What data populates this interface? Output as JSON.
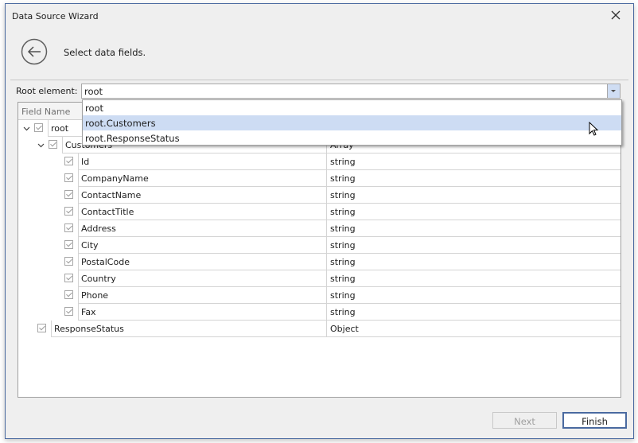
{
  "window": {
    "title": "Data Source Wizard",
    "close_icon": "close-icon",
    "back_icon": "back-arrow-icon",
    "subtitle": "Select data fields."
  },
  "root_element": {
    "label": "Root element:",
    "value": "root",
    "options": [
      {
        "label": "root",
        "selected": false
      },
      {
        "label": "root.Customers",
        "selected": true
      },
      {
        "label": "root.ResponseStatus",
        "selected": false
      }
    ]
  },
  "grid": {
    "header_field_name": "Field Name",
    "rows": [
      {
        "name": "root",
        "type": "",
        "level": 0,
        "expandable": true,
        "checked": true
      },
      {
        "name": "Customers",
        "type": "Array",
        "level": 1,
        "expandable": true,
        "checked": true
      },
      {
        "name": "Id",
        "type": "string",
        "level": 2,
        "expandable": false,
        "checked": true
      },
      {
        "name": "CompanyName",
        "type": "string",
        "level": 2,
        "expandable": false,
        "checked": true
      },
      {
        "name": "ContactName",
        "type": "string",
        "level": 2,
        "expandable": false,
        "checked": true
      },
      {
        "name": "ContactTitle",
        "type": "string",
        "level": 2,
        "expandable": false,
        "checked": true
      },
      {
        "name": "Address",
        "type": "string",
        "level": 2,
        "expandable": false,
        "checked": true
      },
      {
        "name": "City",
        "type": "string",
        "level": 2,
        "expandable": false,
        "checked": true
      },
      {
        "name": "PostalCode",
        "type": "string",
        "level": 2,
        "expandable": false,
        "checked": true
      },
      {
        "name": "Country",
        "type": "string",
        "level": 2,
        "expandable": false,
        "checked": true
      },
      {
        "name": "Phone",
        "type": "string",
        "level": 2,
        "expandable": false,
        "checked": true
      },
      {
        "name": "Fax",
        "type": "string",
        "level": 2,
        "expandable": false,
        "checked": true
      },
      {
        "name": "ResponseStatus",
        "type": "Object",
        "level": 1,
        "expandable": false,
        "checked": true
      }
    ]
  },
  "footer": {
    "next_label": "Next",
    "next_enabled": false,
    "finish_label": "Finish"
  }
}
